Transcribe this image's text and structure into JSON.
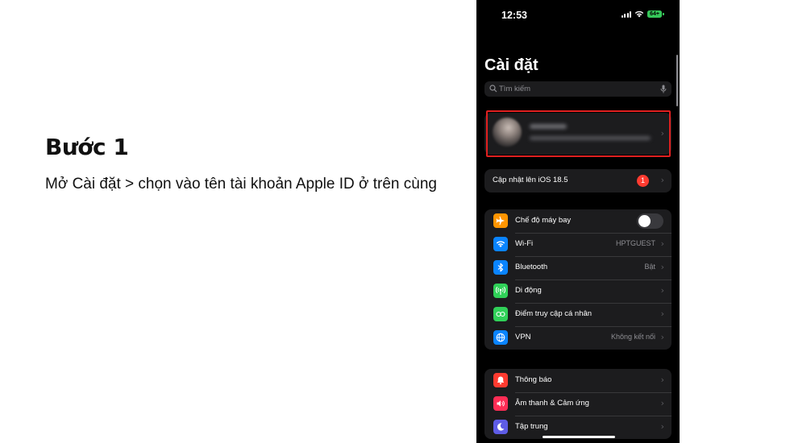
{
  "step": {
    "title": "Bước 1",
    "description": "Mở Cài đặt > chọn vào tên tài khoản Apple ID ở trên cùng"
  },
  "status_bar": {
    "time": "12:53",
    "battery": "64+"
  },
  "settings": {
    "title": "Cài đặt",
    "search_placeholder": "Tìm kiếm",
    "update": {
      "label": "Cập nhật lên iOS 18.5",
      "badge": "1"
    },
    "connectivity": [
      {
        "label": "Chế độ máy bay",
        "icon": "airplane-icon",
        "color": "#ff9500",
        "toggle": false
      },
      {
        "label": "Wi-Fi",
        "icon": "wifi-icon",
        "color": "#0a84ff",
        "value": "HPTGUEST"
      },
      {
        "label": "Bluetooth",
        "icon": "bluetooth-icon",
        "color": "#0a84ff",
        "value": "Bật"
      },
      {
        "label": "Di động",
        "icon": "cellular-icon",
        "color": "#30d158"
      },
      {
        "label": "Điểm truy cập cá nhân",
        "icon": "hotspot-icon",
        "color": "#30d158"
      },
      {
        "label": "VPN",
        "icon": "vpn-icon",
        "color": "#0a84ff",
        "value": "Không kết nối"
      }
    ],
    "notifications": [
      {
        "label": "Thông báo",
        "icon": "notifications-icon",
        "color": "#ff3b30"
      },
      {
        "label": "Âm thanh & Cảm ứng",
        "icon": "sound-icon",
        "color": "#ff2d55"
      },
      {
        "label": "Tập trung",
        "icon": "focus-icon",
        "color": "#5e5ce6"
      }
    ]
  },
  "colors": {
    "highlight": "#e02020",
    "background": "#000000",
    "cell": "#1c1c1e"
  }
}
